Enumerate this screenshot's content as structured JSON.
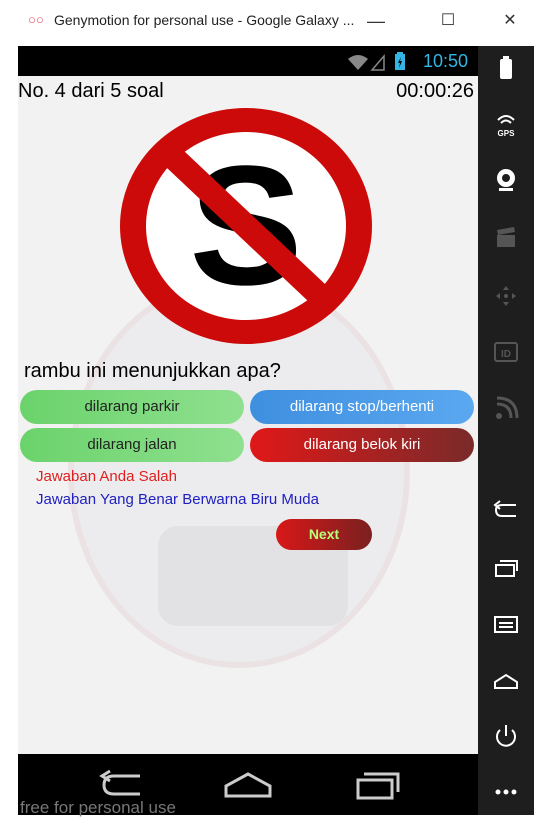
{
  "window": {
    "logo": "○○",
    "title": "Genymotion for personal use - Google Galaxy ...",
    "minimize": "—",
    "maximize": "☐",
    "close": "✕"
  },
  "status_bar": {
    "time": "10:50"
  },
  "quiz": {
    "question_number": "No. 4 dari 5 soal",
    "timer": "00:00:26",
    "question": "rambu ini menunjukkan apa?",
    "answers": [
      {
        "label": "dilarang parkir",
        "color": "green"
      },
      {
        "label": "dilarang stop/berhenti",
        "color": "blue"
      },
      {
        "label": "dilarang jalan",
        "color": "green"
      },
      {
        "label": "dilarang belok kiri",
        "color": "red"
      }
    ],
    "feedback_wrong": "Jawaban Anda Salah",
    "feedback_correct": "Jawaban Yang Benar Berwarna Biru Muda",
    "next_label": "Next"
  },
  "footer": {
    "watermark": "free for personal use"
  },
  "colors": {
    "accent_blue": "#33b5e5",
    "wrong_red": "#e02020",
    "correct_blue": "#2020c0",
    "sign_red": "#cc0a0a"
  },
  "sidebar_icons": [
    "battery-icon",
    "gps-icon",
    "webcam-icon",
    "clapper-icon",
    "dpad-icon",
    "id-icon",
    "cast-icon",
    "back-icon",
    "recents-icon",
    "menu-icon",
    "home-icon",
    "power-icon",
    "more-icon"
  ]
}
